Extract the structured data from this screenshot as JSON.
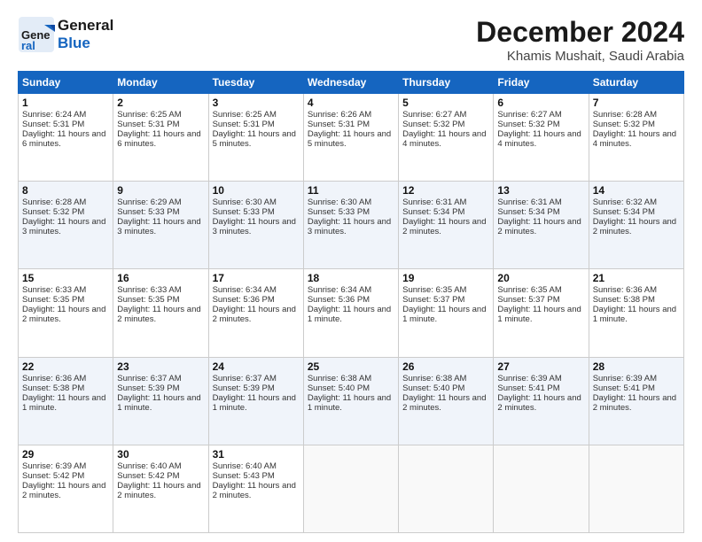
{
  "header": {
    "logo_line1": "General",
    "logo_line2": "Blue",
    "month_title": "December 2024",
    "location": "Khamis Mushait, Saudi Arabia"
  },
  "days_of_week": [
    "Sunday",
    "Monday",
    "Tuesday",
    "Wednesday",
    "Thursday",
    "Friday",
    "Saturday"
  ],
  "weeks": [
    [
      {
        "day": "1",
        "sunrise": "6:24 AM",
        "sunset": "5:31 PM",
        "daylight": "11 hours and 6 minutes."
      },
      {
        "day": "2",
        "sunrise": "6:25 AM",
        "sunset": "5:31 PM",
        "daylight": "11 hours and 6 minutes."
      },
      {
        "day": "3",
        "sunrise": "6:25 AM",
        "sunset": "5:31 PM",
        "daylight": "11 hours and 5 minutes."
      },
      {
        "day": "4",
        "sunrise": "6:26 AM",
        "sunset": "5:31 PM",
        "daylight": "11 hours and 5 minutes."
      },
      {
        "day": "5",
        "sunrise": "6:27 AM",
        "sunset": "5:32 PM",
        "daylight": "11 hours and 4 minutes."
      },
      {
        "day": "6",
        "sunrise": "6:27 AM",
        "sunset": "5:32 PM",
        "daylight": "11 hours and 4 minutes."
      },
      {
        "day": "7",
        "sunrise": "6:28 AM",
        "sunset": "5:32 PM",
        "daylight": "11 hours and 4 minutes."
      }
    ],
    [
      {
        "day": "8",
        "sunrise": "6:28 AM",
        "sunset": "5:32 PM",
        "daylight": "11 hours and 3 minutes."
      },
      {
        "day": "9",
        "sunrise": "6:29 AM",
        "sunset": "5:33 PM",
        "daylight": "11 hours and 3 minutes."
      },
      {
        "day": "10",
        "sunrise": "6:30 AM",
        "sunset": "5:33 PM",
        "daylight": "11 hours and 3 minutes."
      },
      {
        "day": "11",
        "sunrise": "6:30 AM",
        "sunset": "5:33 PM",
        "daylight": "11 hours and 3 minutes."
      },
      {
        "day": "12",
        "sunrise": "6:31 AM",
        "sunset": "5:34 PM",
        "daylight": "11 hours and 2 minutes."
      },
      {
        "day": "13",
        "sunrise": "6:31 AM",
        "sunset": "5:34 PM",
        "daylight": "11 hours and 2 minutes."
      },
      {
        "day": "14",
        "sunrise": "6:32 AM",
        "sunset": "5:34 PM",
        "daylight": "11 hours and 2 minutes."
      }
    ],
    [
      {
        "day": "15",
        "sunrise": "6:33 AM",
        "sunset": "5:35 PM",
        "daylight": "11 hours and 2 minutes."
      },
      {
        "day": "16",
        "sunrise": "6:33 AM",
        "sunset": "5:35 PM",
        "daylight": "11 hours and 2 minutes."
      },
      {
        "day": "17",
        "sunrise": "6:34 AM",
        "sunset": "5:36 PM",
        "daylight": "11 hours and 2 minutes."
      },
      {
        "day": "18",
        "sunrise": "6:34 AM",
        "sunset": "5:36 PM",
        "daylight": "11 hours and 1 minute."
      },
      {
        "day": "19",
        "sunrise": "6:35 AM",
        "sunset": "5:37 PM",
        "daylight": "11 hours and 1 minute."
      },
      {
        "day": "20",
        "sunrise": "6:35 AM",
        "sunset": "5:37 PM",
        "daylight": "11 hours and 1 minute."
      },
      {
        "day": "21",
        "sunrise": "6:36 AM",
        "sunset": "5:38 PM",
        "daylight": "11 hours and 1 minute."
      }
    ],
    [
      {
        "day": "22",
        "sunrise": "6:36 AM",
        "sunset": "5:38 PM",
        "daylight": "11 hours and 1 minute."
      },
      {
        "day": "23",
        "sunrise": "6:37 AM",
        "sunset": "5:39 PM",
        "daylight": "11 hours and 1 minute."
      },
      {
        "day": "24",
        "sunrise": "6:37 AM",
        "sunset": "5:39 PM",
        "daylight": "11 hours and 1 minute."
      },
      {
        "day": "25",
        "sunrise": "6:38 AM",
        "sunset": "5:40 PM",
        "daylight": "11 hours and 1 minute."
      },
      {
        "day": "26",
        "sunrise": "6:38 AM",
        "sunset": "5:40 PM",
        "daylight": "11 hours and 2 minutes."
      },
      {
        "day": "27",
        "sunrise": "6:39 AM",
        "sunset": "5:41 PM",
        "daylight": "11 hours and 2 minutes."
      },
      {
        "day": "28",
        "sunrise": "6:39 AM",
        "sunset": "5:41 PM",
        "daylight": "11 hours and 2 minutes."
      }
    ],
    [
      {
        "day": "29",
        "sunrise": "6:39 AM",
        "sunset": "5:42 PM",
        "daylight": "11 hours and 2 minutes."
      },
      {
        "day": "30",
        "sunrise": "6:40 AM",
        "sunset": "5:42 PM",
        "daylight": "11 hours and 2 minutes."
      },
      {
        "day": "31",
        "sunrise": "6:40 AM",
        "sunset": "5:43 PM",
        "daylight": "11 hours and 2 minutes."
      },
      null,
      null,
      null,
      null
    ]
  ]
}
